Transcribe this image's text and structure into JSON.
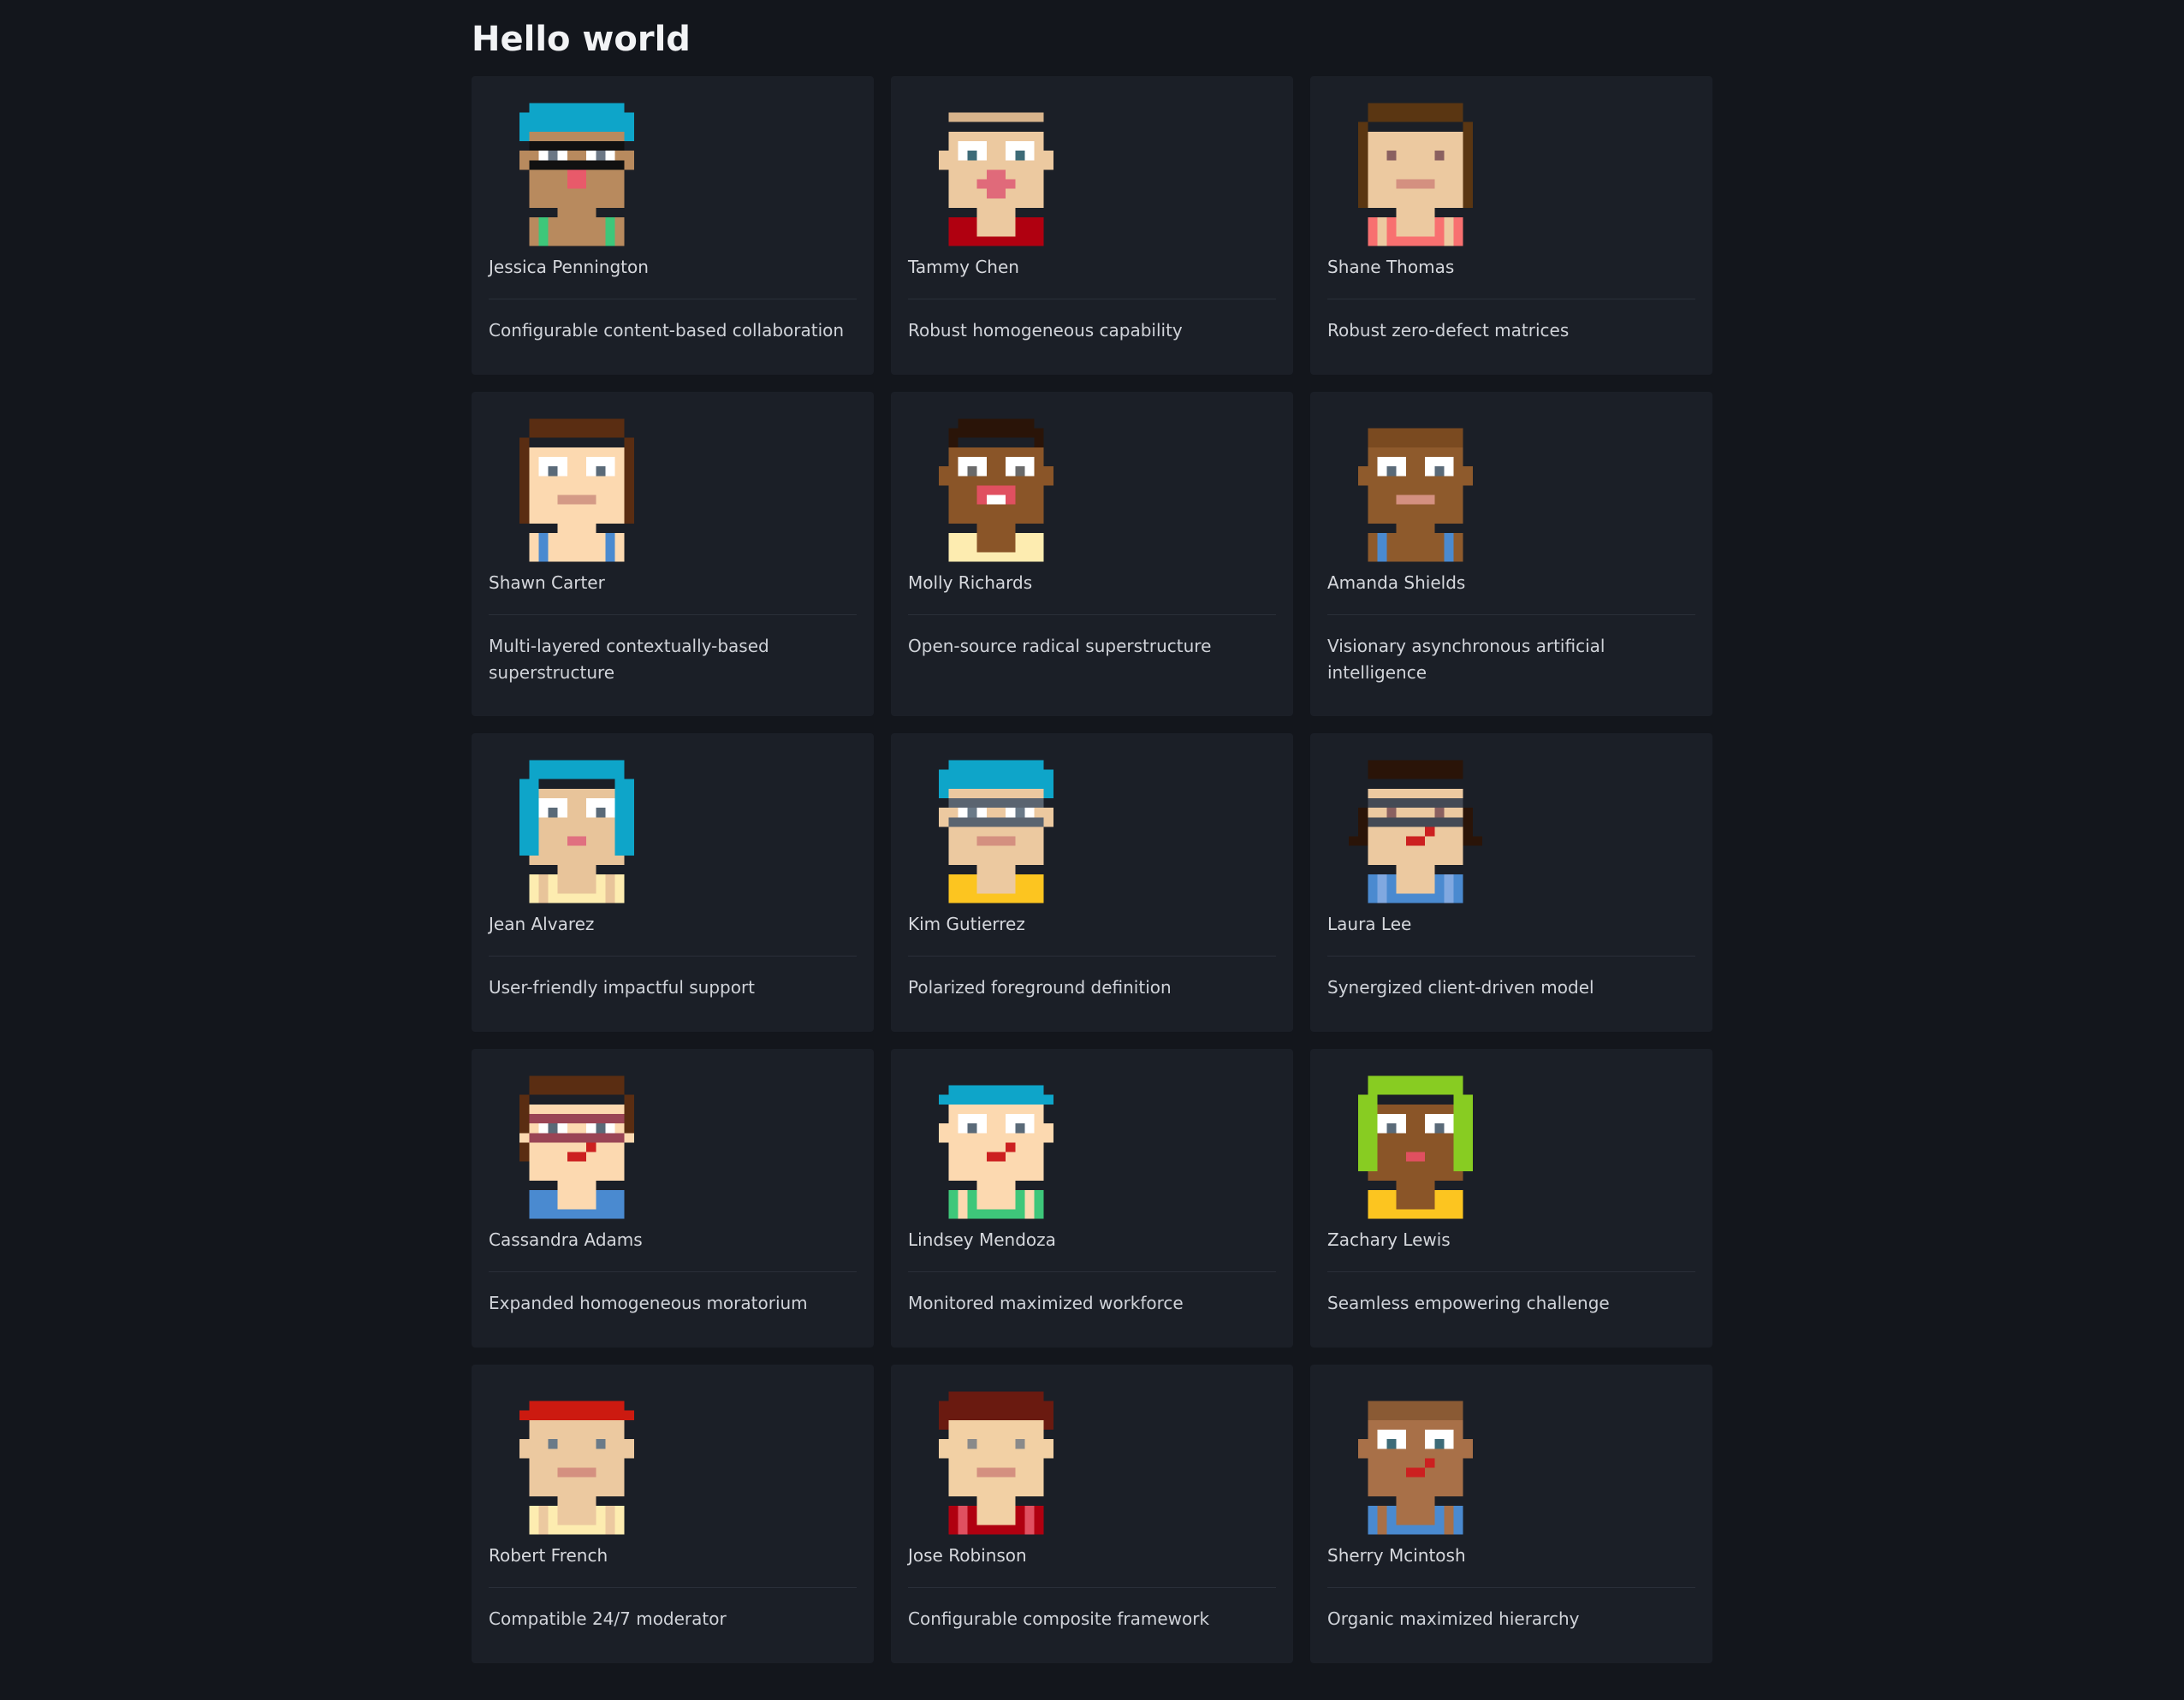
{
  "page": {
    "title": "Hello world"
  },
  "colors": {
    "background": "#13161c",
    "card": "#1b1f27",
    "divider": "#2a2f39"
  },
  "people": [
    {
      "name": "Jessica Pennington",
      "tagline": "Configurable content-based collaboration",
      "avatar": {
        "skin": "#b88a5e",
        "hair": "#0ea5c9",
        "hairStyle": "bowl",
        "eye": "#ffffff",
        "pupil": "#6b7785",
        "mouth": "#e85a6a",
        "shirt": "#b88a5e",
        "shirtAccent": "#3ec77a",
        "glasses": "#111111",
        "mouthStyle": "open"
      }
    },
    {
      "name": "Tammy Chen",
      "tagline": "Robust homogeneous capability",
      "avatar": {
        "skin": "#ecc9a0",
        "hair": "#ecc9a0",
        "hairStyle": "bald",
        "eye": "#ffffff",
        "pupil": "#3d6b78",
        "mouth": "#e06a7a",
        "shirt": "#b00010",
        "shirtAccent": "#b00010",
        "glasses": "",
        "mouthStyle": "lips"
      }
    },
    {
      "name": "Shane Thomas",
      "tagline": "Robust zero-defect matrices",
      "avatar": {
        "skin": "#ecc9a0",
        "hair": "#5a3612",
        "hairStyle": "long",
        "eye": "#ecc9a0",
        "pupil": "#8a6060",
        "mouth": "#d49080",
        "shirt": "#f87070",
        "shirtAccent": "#ecc9a0",
        "glasses": "",
        "mouthStyle": "line"
      }
    },
    {
      "name": "Shawn Carter",
      "tagline": "Multi-layered contextually-based superstructure",
      "avatar": {
        "skin": "#fcd9b0",
        "hair": "#5a2d12",
        "hairStyle": "long",
        "eye": "#ffffff",
        "pupil": "#5a6a78",
        "mouth": "#d49a86",
        "shirt": "#fcd9b0",
        "shirtAccent": "#4a8ad0",
        "glasses": "",
        "mouthStyle": "line"
      }
    },
    {
      "name": "Molly Richards",
      "tagline": "Open-source radical superstructure",
      "avatar": {
        "skin": "#8a5528",
        "hair": "#2a1408",
        "hairStyle": "top",
        "eye": "#ffffff",
        "pupil": "#6a6a6a",
        "mouth": "#e05060",
        "shirt": "#fdecb0",
        "shirtAccent": "#fdecb0",
        "glasses": "",
        "mouthStyle": "teeth"
      }
    },
    {
      "name": "Amanda Shields",
      "tagline": "Visionary asynchronous artificial intelligence",
      "avatar": {
        "skin": "#8e5a2c",
        "hair": "#7a4a20",
        "hairStyle": "buzz",
        "eye": "#ffffff",
        "pupil": "#5a6a78",
        "mouth": "#d49080",
        "shirt": "#8e5a2c",
        "shirtAccent": "#4a8ad0",
        "glasses": "",
        "mouthStyle": "line"
      }
    },
    {
      "name": "Jean Alvarez",
      "tagline": "User-friendly impactful support",
      "avatar": {
        "skin": "#e8c49a",
        "hair": "#0ea5c9",
        "hairStyle": "sides",
        "eye": "#ffffff",
        "pupil": "#5a6a78",
        "mouth": "#e07080",
        "shirt": "#fdecb0",
        "shirtAccent": "#e8c49a",
        "glasses": "",
        "mouthStyle": "small"
      }
    },
    {
      "name": "Kim Gutierrez",
      "tagline": "Polarized foreground definition",
      "avatar": {
        "skin": "#ecc9a0",
        "hair": "#0ea5c9",
        "hairStyle": "bowl",
        "eye": "#ffffff",
        "pupil": "#6a7a88",
        "mouth": "#d49080",
        "shirt": "#fcc520",
        "shirtAccent": "#fcc520",
        "glasses": "#5a6470",
        "mouthStyle": "line"
      }
    },
    {
      "name": "Laura Lee",
      "tagline": "Synergized client-driven model",
      "avatar": {
        "skin": "#ecc9a0",
        "hair": "#2a1408",
        "hairStyle": "pigtails",
        "eye": "#ecc9a0",
        "pupil": "#8a6060",
        "mouth": "#cc2020",
        "shirt": "#4a8ad0",
        "shirtAccent": "#80a8e0",
        "glasses": "#444a55",
        "mouthStyle": "side"
      }
    },
    {
      "name": "Cassandra Adams",
      "tagline": "Expanded homogeneous moratorium",
      "avatar": {
        "skin": "#fcd9b0",
        "hair": "#5a2d12",
        "hairStyle": "braid",
        "eye": "#ffffff",
        "pupil": "#5a6a78",
        "mouth": "#cc2020",
        "shirt": "#4a8ad0",
        "shirtAccent": "#4a8ad0",
        "glasses": "#9a4455",
        "mouthStyle": "side"
      }
    },
    {
      "name": "Lindsey Mendoza",
      "tagline": "Monitored maximized workforce",
      "avatar": {
        "skin": "#fcd9b0",
        "hair": "#0ea5c9",
        "hairStyle": "cap",
        "eye": "#ffffff",
        "pupil": "#5a6a78",
        "mouth": "#cc2020",
        "shirt": "#3ec77a",
        "shirtAccent": "#fcd9b0",
        "glasses": "",
        "mouthStyle": "side"
      }
    },
    {
      "name": "Zachary Lewis",
      "tagline": "Seamless empowering challenge",
      "avatar": {
        "skin": "#8a5528",
        "hair": "#88cc22",
        "hairStyle": "sides",
        "eye": "#ffffff",
        "pupil": "#5a6a78",
        "mouth": "#e05060",
        "shirt": "#fcc520",
        "shirtAccent": "#fcc520",
        "glasses": "",
        "mouthStyle": "small"
      }
    },
    {
      "name": "Robert French",
      "tagline": "Compatible 24/7 moderator",
      "avatar": {
        "skin": "#ecc9a0",
        "hair": "#cc1a10",
        "hairStyle": "cap",
        "eye": "#ecc9a0",
        "pupil": "#6a7a88",
        "mouth": "#d49080",
        "shirt": "#fdecb0",
        "shirtAccent": "#ecc9a0",
        "glasses": "",
        "mouthStyle": "line"
      }
    },
    {
      "name": "Jose Robinson",
      "tagline": "Configurable composite framework",
      "avatar": {
        "skin": "#f2d0a4",
        "hair": "#6a1a10",
        "hairStyle": "bowl",
        "eye": "#f2d0a4",
        "pupil": "#8a8a8a",
        "mouth": "#d49080",
        "shirt": "#b00010",
        "shirtAccent": "#e05060",
        "glasses": "",
        "mouthStyle": "line"
      }
    },
    {
      "name": "Sherry Mcintosh",
      "tagline": "Organic maximized hierarchy",
      "avatar": {
        "skin": "#a87048",
        "hair": "#8a5a34",
        "hairStyle": "buzz",
        "eye": "#ffffff",
        "pupil": "#3d6b78",
        "mouth": "#cc2020",
        "shirt": "#4a8ad0",
        "shirtAccent": "#a87048",
        "glasses": "",
        "mouthStyle": "side"
      }
    }
  ]
}
